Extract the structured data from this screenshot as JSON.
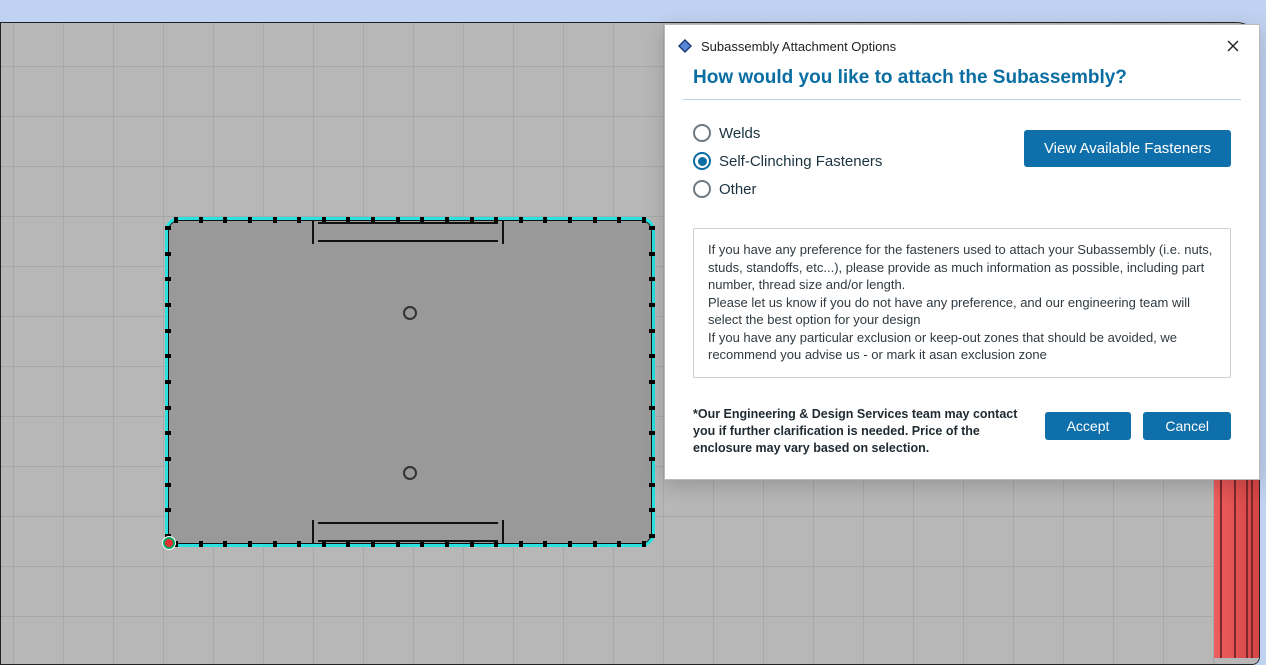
{
  "dialog": {
    "title": "Subassembly Attachment Options",
    "heading": "How would you like to attach the Subassembly?",
    "options": [
      {
        "label": "Welds",
        "selected": false
      },
      {
        "label": "Self-Clinching Fasteners",
        "selected": true
      },
      {
        "label": "Other",
        "selected": false
      }
    ],
    "view_fasteners_label": "View Available Fasteners",
    "instructions_line1": "If you have any preference for the fasteners used to attach your Subassembly (i.e. nuts, studs, standoffs, etc...), please provide as much information as possible, including part number, thread size and/or length.",
    "instructions_line2": "Please let us know if you do not have any preference, and our engineering team will select the best option for your design",
    "instructions_line3": "If you have any particular exclusion or keep-out zones that should be avoided, we recommend you advise us - or mark it asan exclusion zone",
    "disclaimer": "*Our Engineering & Design Services team may contact you if further clarification is needed. Price of the enclosure may vary based on selection.",
    "accept_label": "Accept",
    "cancel_label": "Cancel"
  }
}
